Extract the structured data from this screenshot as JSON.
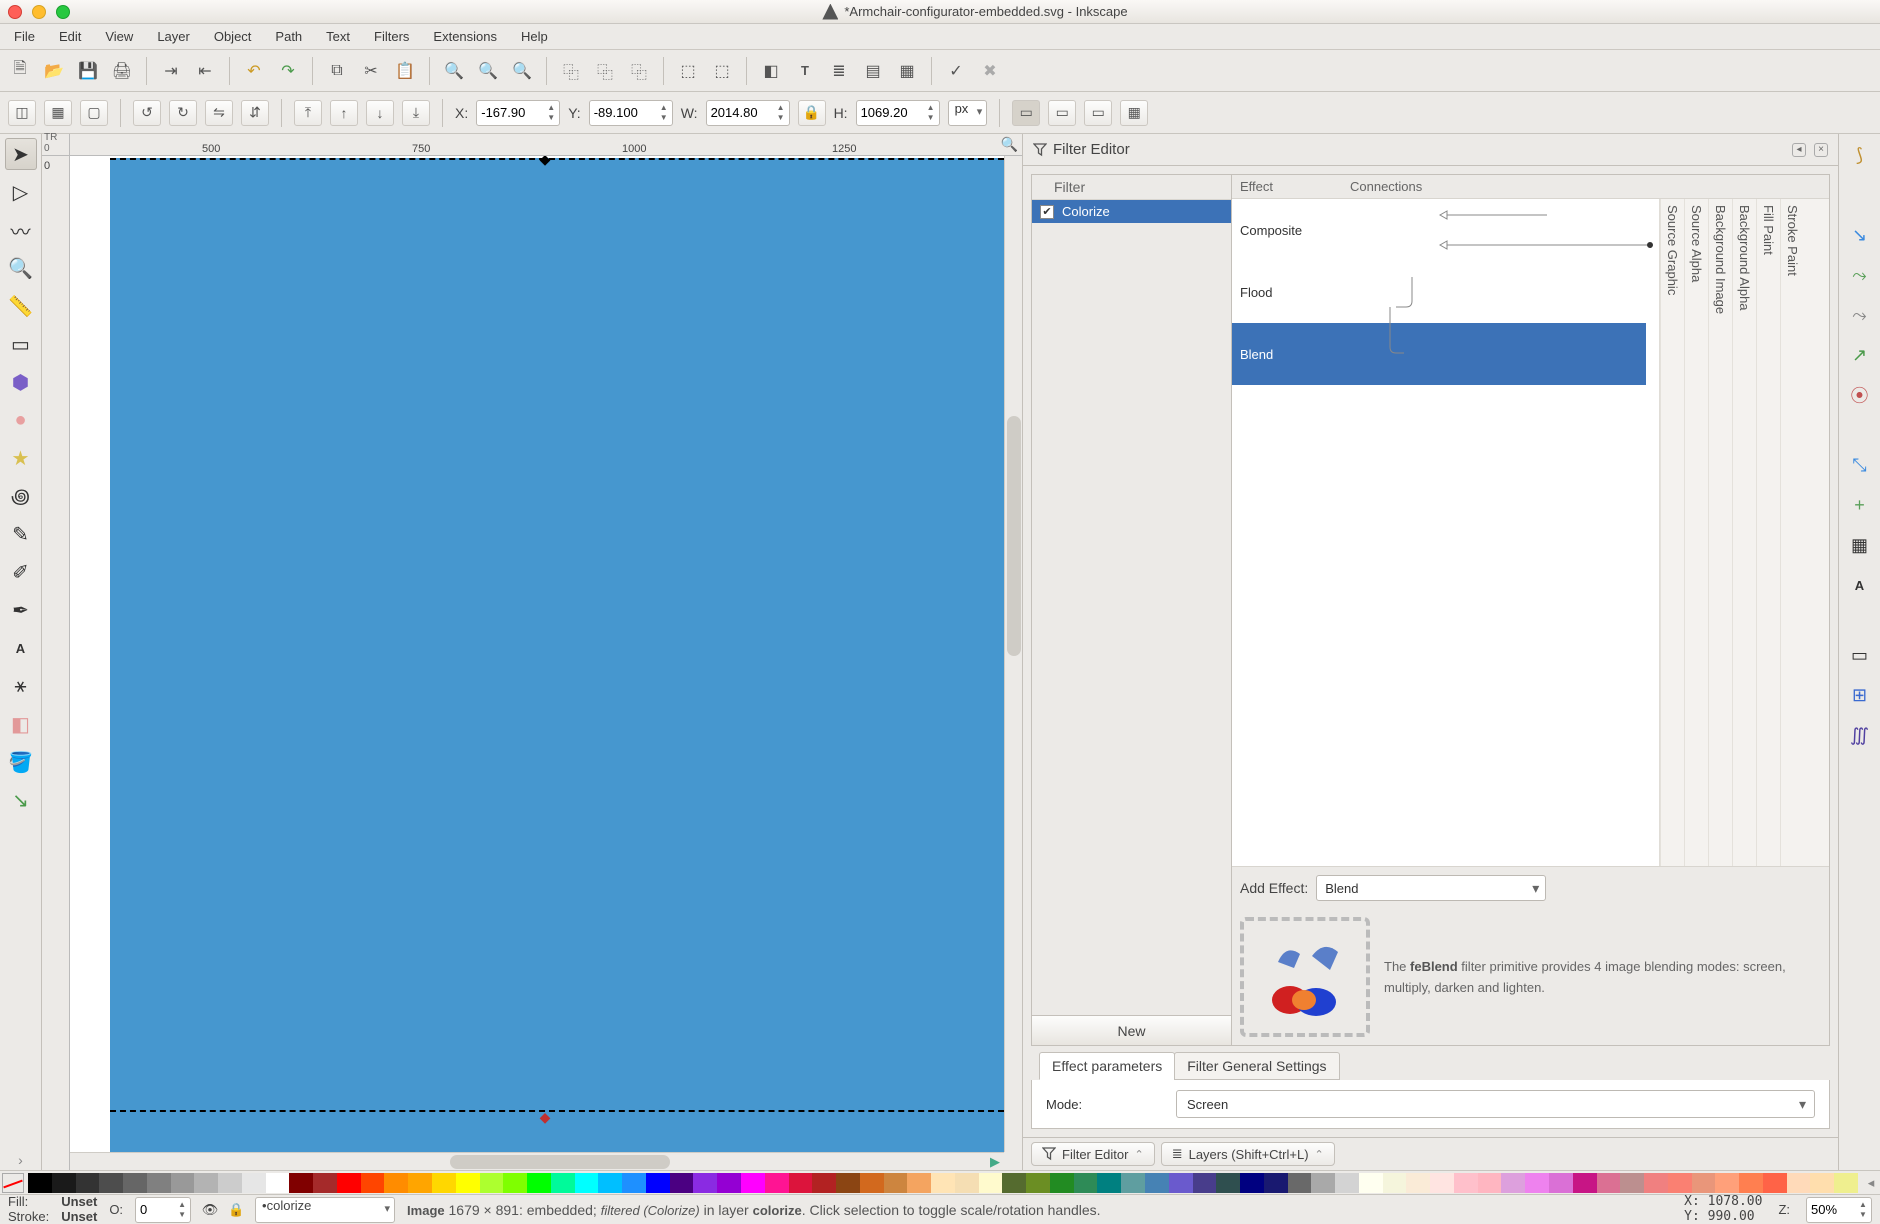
{
  "title": "*Armchair-configurator-embedded.svg - Inkscape",
  "menu": [
    "File",
    "Edit",
    "View",
    "Layer",
    "Object",
    "Path",
    "Text",
    "Filters",
    "Extensions",
    "Help"
  ],
  "xywh": {
    "x": "-167.90",
    "y": "-89.100",
    "w": "2014.80",
    "h": "1069.20"
  },
  "unit": "px",
  "hruler": {
    "t1": "500",
    "t2": "750",
    "t3": "1000",
    "t4": "1250"
  },
  "filterpanel": {
    "title": "Filter Editor",
    "filterCol": "Filter",
    "effectCol": "Effect",
    "connCol": "Connections",
    "filter": "Colorize",
    "effects": [
      "Composite",
      "Flood",
      "Blend"
    ],
    "connLabels": [
      "Source Graphic",
      "Source Alpha",
      "Background Image",
      "Background Alpha",
      "Fill Paint",
      "Stroke Paint"
    ],
    "addLabel": "Add Effect:",
    "addValue": "Blend",
    "newBtn": "New",
    "descPrimitive": "feBlend",
    "desc1": "The ",
    "desc2": " filter primitive provides 4 image blending modes: screen, multiply, darken and lighten.",
    "tabs": {
      "params": "Effect parameters",
      "general": "Filter General Settings"
    },
    "modeLabel": "Mode:",
    "modeValue": "Screen",
    "dock1": "Filter Editor",
    "dock2": "Layers (Shift+Ctrl+L)"
  },
  "status": {
    "fill": "Fill:",
    "stroke": "Stroke:",
    "fillv": "Unset",
    "strokev": "Unset",
    "opLabel": "O:",
    "opVal": "0",
    "layer": "•colorize",
    "desc": "Image 1679 × 891: embedded; filtered (Colorize) in layer colorize. Click selection to toggle scale/rotation handles.",
    "coords": "X: 1078.00\nY: 990.00",
    "zLabel": "Z:",
    "zVal": "50%"
  },
  "palette": [
    "#000000",
    "#1a1a1a",
    "#333333",
    "#4d4d4d",
    "#666666",
    "#808080",
    "#999999",
    "#b3b3b3",
    "#cccccc",
    "#e6e6e6",
    "#ffffff",
    "#800000",
    "#a52a2a",
    "#ff0000",
    "#ff4500",
    "#ff8c00",
    "#ffa500",
    "#ffd700",
    "#ffff00",
    "#adff2f",
    "#7fff00",
    "#00ff00",
    "#00fa9a",
    "#00ffff",
    "#00bfff",
    "#1e90ff",
    "#0000ff",
    "#4b0082",
    "#8a2be2",
    "#9400d3",
    "#ff00ff",
    "#ff1493",
    "#dc143c",
    "#b22222",
    "#8b4513",
    "#d2691e",
    "#cd853f",
    "#f4a460",
    "#ffe4b5",
    "#f5deb3",
    "#fffacd",
    "#556b2f",
    "#6b8e23",
    "#228b22",
    "#2e8b57",
    "#008080",
    "#5f9ea0",
    "#4682b4",
    "#6a5acd",
    "#483d8b",
    "#2f4f4f",
    "#000080",
    "#191970",
    "#696969",
    "#a9a9a9",
    "#d3d3d3",
    "#fffff0",
    "#f5f5dc",
    "#faebd7",
    "#ffe4e1",
    "#ffc0cb",
    "#ffb6c1",
    "#dda0dd",
    "#ee82ee",
    "#da70d6",
    "#c71585",
    "#db7093",
    "#bc8f8f",
    "#f08080",
    "#fa8072",
    "#e9967a",
    "#ffa07a",
    "#ff7f50",
    "#ff6347",
    "#ffdab9",
    "#ffdead",
    "#efef8f"
  ]
}
